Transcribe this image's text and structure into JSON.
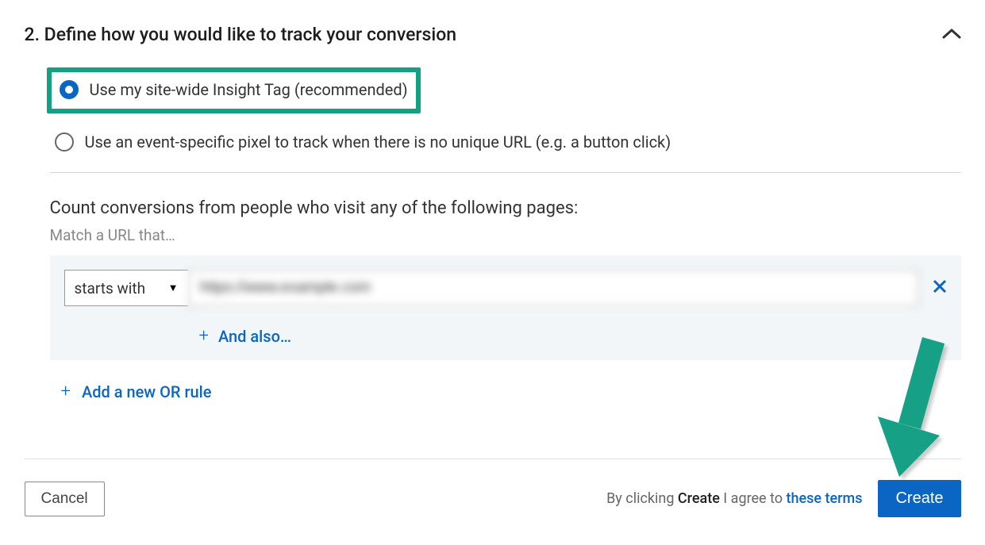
{
  "section": {
    "title": "2. Define how you would like to track your conversion"
  },
  "radio": {
    "option1": "Use my site-wide Insight Tag (recommended)",
    "option2": "Use an event-specific pixel to track when there is no unique URL (e.g. a button click)"
  },
  "count": {
    "heading": "Count conversions from people who visit any of the following pages:",
    "sub": "Match a URL that…"
  },
  "rule": {
    "select_label": "starts with",
    "url_value": "https://www.example.com",
    "and_also": "And also…",
    "add_or": "Add a new OR rule"
  },
  "footer": {
    "cancel": "Cancel",
    "terms_prefix": "By clicking ",
    "terms_strong": "Create",
    "terms_mid": " I agree to ",
    "terms_link": "these terms",
    "create": "Create"
  }
}
